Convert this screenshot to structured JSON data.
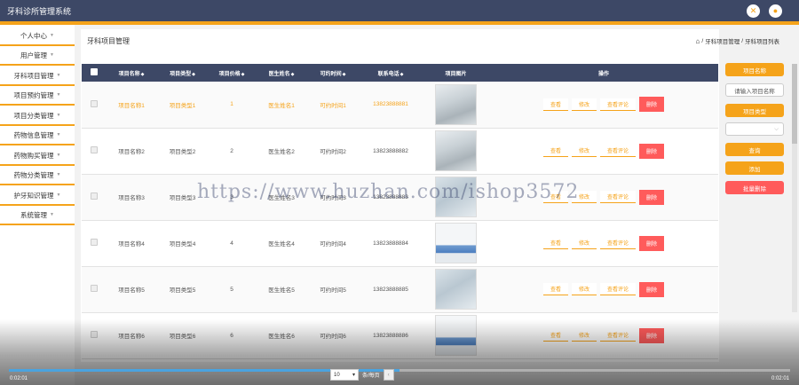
{
  "app": {
    "title": "牙科诊所管理系统"
  },
  "header_icons": [
    "expand-icon",
    "user-icon"
  ],
  "sidebar": {
    "items": [
      {
        "label": "个人中心"
      },
      {
        "label": "用户管理"
      },
      {
        "label": "牙科项目管理"
      },
      {
        "label": "项目预约管理"
      },
      {
        "label": "项目分类管理"
      },
      {
        "label": "药物信息管理"
      },
      {
        "label": "药物购买管理"
      },
      {
        "label": "药物分类管理"
      },
      {
        "label": "护牙知识管理"
      },
      {
        "label": "系统管理"
      }
    ]
  },
  "page": {
    "title": "牙科项目管理",
    "breadcrumb": [
      "牙科项目管理",
      "牙科项目列表"
    ]
  },
  "table": {
    "headers": [
      "项目名称",
      "项目类型",
      "项目价格",
      "医生姓名",
      "可约时间",
      "联系电话",
      "项目图片",
      "操作"
    ],
    "rows": [
      {
        "name": "项目名称1",
        "type": "项目类型1",
        "price": "1",
        "doctor": "医生姓名1",
        "time": "可约时间1",
        "phone": "13823888881",
        "image": "room"
      },
      {
        "name": "项目名称2",
        "type": "项目类型2",
        "price": "2",
        "doctor": "医生姓名2",
        "time": "可约时间2",
        "phone": "13823888882",
        "image": "room"
      },
      {
        "name": "项目名称3",
        "type": "项目类型3",
        "price": "3",
        "doctor": "医生姓名3",
        "time": "可约时间3",
        "phone": "13823888883",
        "image": "room2"
      },
      {
        "name": "项目名称4",
        "type": "项目类型4",
        "price": "4",
        "doctor": "医生姓名4",
        "time": "可约时间4",
        "phone": "13823888884",
        "image": "chair"
      },
      {
        "name": "项目名称5",
        "type": "项目类型5",
        "price": "5",
        "doctor": "医生姓名5",
        "time": "可约时间5",
        "phone": "13823888885",
        "image": "room2"
      },
      {
        "name": "项目名称6",
        "type": "项目类型6",
        "price": "6",
        "doctor": "医生姓名6",
        "time": "可约时间6",
        "phone": "13823888886",
        "image": "chair"
      }
    ],
    "actions": {
      "view": "查看",
      "edit": "修改",
      "comments": "查看评论",
      "delete": "删除"
    }
  },
  "search_panel": {
    "name_label": "项目名称",
    "name_placeholder": "请输入项目名称",
    "type_label": "项目类型",
    "search_button": "查询",
    "add_button": "添加",
    "batch_delete_button": "批量删除"
  },
  "pagination": {
    "page_size": "10",
    "per_page_label": "条/每页"
  },
  "video": {
    "current_time": "0:02:01",
    "total_time": "0:02:01",
    "progress": 0.5
  },
  "watermark": "https://www.huzhan.com/ishop3572",
  "colors": {
    "header": "#3d4866",
    "accent": "#f5a31a",
    "danger": "#ff5b5b"
  }
}
